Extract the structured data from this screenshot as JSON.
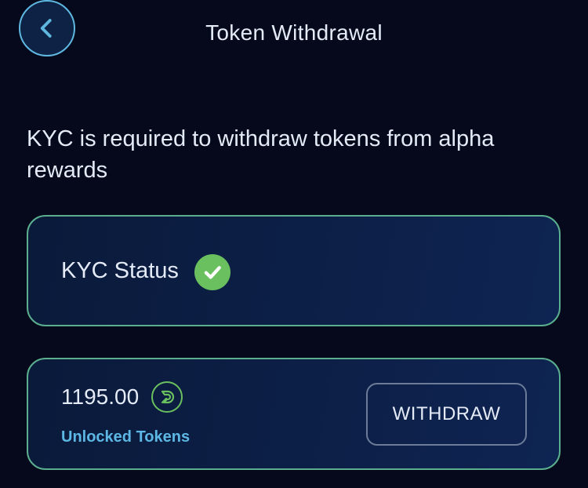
{
  "header": {
    "title": "Token Withdrawal",
    "back_icon": "chevron-left-icon"
  },
  "notice": {
    "text": "KYC is required to withdraw tokens from alpha rewards"
  },
  "kyc_card": {
    "label": "KYC Status",
    "status_icon": "check-circle-icon",
    "status_color": "#6abf5e"
  },
  "balance_card": {
    "amount": "1195.00",
    "token_icon": "token-logo-icon",
    "caption": "Unlocked Tokens",
    "caption_color": "#5db7e4",
    "withdraw_label": "WITHDRAW"
  },
  "colors": {
    "background": "#05091b",
    "card_border": "#5aae8e",
    "accent_blue": "#5fb8e0",
    "accent_green": "#6abf5e"
  }
}
